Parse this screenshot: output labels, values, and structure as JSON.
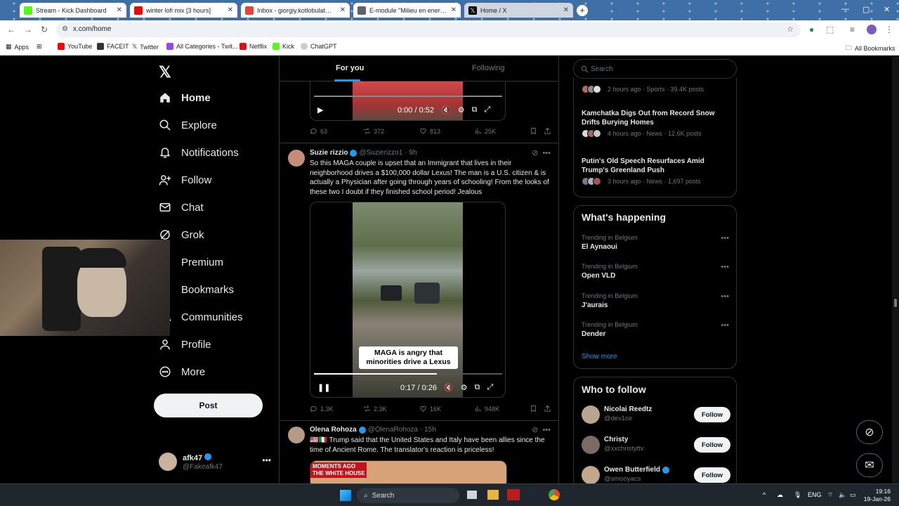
{
  "browser": {
    "tabs": [
      {
        "title": "Stream - Kick Dashboard",
        "color": "#53fc18"
      },
      {
        "title": "winter lofi mix [3 hours]",
        "color": "#ff0000"
      },
      {
        "title": "Inbox - giorgiy.kotlobulat@vdab",
        "color": "#ea4335"
      },
      {
        "title": "E-module \"Milieu en energie in",
        "color": "#5f6368"
      },
      {
        "title": "Home / X",
        "color": "#000000"
      }
    ],
    "url": "x.com/home",
    "bookmarks": [
      "Apps",
      "YouTube",
      "FACEIT",
      "Twitter",
      "All Categories - Twit...",
      "Netflix",
      "Kick",
      "ChatGPT"
    ],
    "all_bookmarks": "All Bookmarks"
  },
  "nav": {
    "items": [
      "Home",
      "Explore",
      "Notifications",
      "Follow",
      "Chat",
      "Grok",
      "Premium",
      "Bookmarks",
      "Communities",
      "Profile",
      "More"
    ],
    "post_label": "Post",
    "account": {
      "name": "afk47",
      "handle": "@Fakeafk47"
    }
  },
  "feed": {
    "tabs": [
      "For you",
      "Following"
    ],
    "top_video": {
      "time": "0:00 / 0:52",
      "stats": {
        "replies": "63",
        "reposts": "372",
        "likes": "813",
        "views": "25K"
      }
    },
    "post1": {
      "name": "Suzie rizzio",
      "handle": "@Suzierizzo1",
      "time": "· 9h",
      "text": "So this MAGA couple is upset that an Immigrant that lives in their neighborhood drives a $100,000 dollar Lexus! The man is a U.S. citizen & is actually a Physician after going through years of schooling! From the looks of these two I doubt if they finished school period! Jealous",
      "caption": "MAGA is angry that minorities drive a Lexus",
      "video_time": "0:17 / 0:26",
      "stats": {
        "replies": "1.3K",
        "reposts": "2.3K",
        "likes": "16K",
        "views": "948K"
      }
    },
    "post2": {
      "name": "Olena Rohoza",
      "handle": "@OlenaRohoza",
      "time": "· 15h",
      "text": "🇺🇸🇮🇹 Trump said that the United States and Italy have been allies since the time of Ancient Rome. The translator's reaction is priceless!",
      "banner": "MOMENTS AGO\nTHE WHITE HOUSE"
    }
  },
  "sidebar": {
    "search_placeholder": "Search",
    "news": [
      {
        "title": "",
        "meta": "2 hours ago · Sports · 39.4K posts"
      },
      {
        "title": "Kamchatka Digs Out from Record Snow Drifts Burying Homes",
        "meta": "4 hours ago · News · 12.6K posts"
      },
      {
        "title": "Putin's Old Speech Resurfaces Amid Trump's Greenland Push",
        "meta": "3 hours ago · News · 1,697 posts"
      }
    ],
    "happening_title": "What's happening",
    "trends": [
      {
        "context": "Trending in Belgium",
        "name": "El Aynaoui"
      },
      {
        "context": "Trending in Belgium",
        "name": "Open VLD"
      },
      {
        "context": "Trending in Belgium",
        "name": "J'aurais"
      },
      {
        "context": "Trending in Belgium",
        "name": "Dender"
      }
    ],
    "show_more": "Show more",
    "wtf_title": "Who to follow",
    "follow_label": "Follow",
    "follows": [
      {
        "name": "Nicolai Reedtz",
        "handle": "@dev1ce"
      },
      {
        "name": "Christy",
        "handle": "@xxchristyttv"
      },
      {
        "name": "Owen Butterfield",
        "handle": "@smooyacs"
      }
    ]
  },
  "taskbar": {
    "search": "Search",
    "lang": "ENG",
    "time": "19:16",
    "date": "19-Jan-26"
  }
}
